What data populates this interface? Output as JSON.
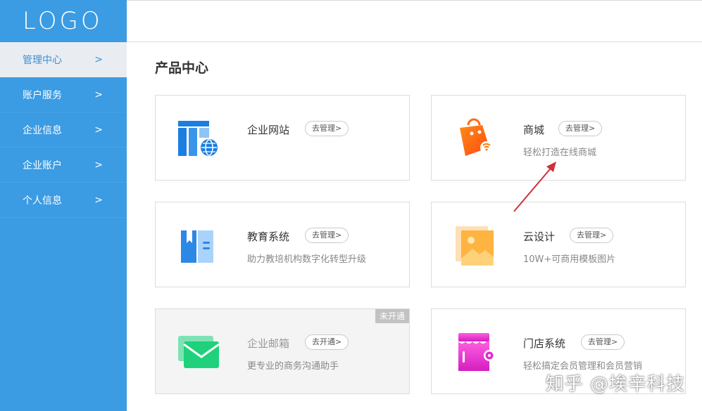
{
  "logo": "LOGO",
  "sidebar": {
    "items": [
      {
        "label": "管理中心"
      },
      {
        "label": "账户服务"
      },
      {
        "label": "企业信息"
      },
      {
        "label": "企业账户"
      },
      {
        "label": "个人信息"
      }
    ],
    "chevron": ">"
  },
  "main": {
    "title": "产品中心",
    "cards": [
      {
        "title": "企业网站",
        "button": "去管理>",
        "desc": "",
        "icon": "website-icon"
      },
      {
        "title": "商城",
        "button": "去管理>",
        "desc": "轻松打造在线商城",
        "icon": "shopping-bag-icon"
      },
      {
        "title": "教育系统",
        "button": "去管理>",
        "desc": "助力教培机构数字化转型升级",
        "icon": "book-icon"
      },
      {
        "title": "云设计",
        "button": "去管理>",
        "desc": "10W+可商用模板图片",
        "icon": "image-icon"
      },
      {
        "title": "企业邮箱",
        "button": "去开通>",
        "desc": "更专业的商务沟通助手",
        "icon": "mail-icon",
        "badge": "未开通"
      },
      {
        "title": "门店系统",
        "button": "去管理>",
        "desc": "轻松搞定会员管理和会员营销",
        "icon": "store-icon"
      }
    ]
  },
  "watermark": "知乎 @埃辛科技",
  "colors": {
    "sidebar": "#3b9be3",
    "active_text": "#3b8fd8",
    "arrow": "#d0313a"
  }
}
